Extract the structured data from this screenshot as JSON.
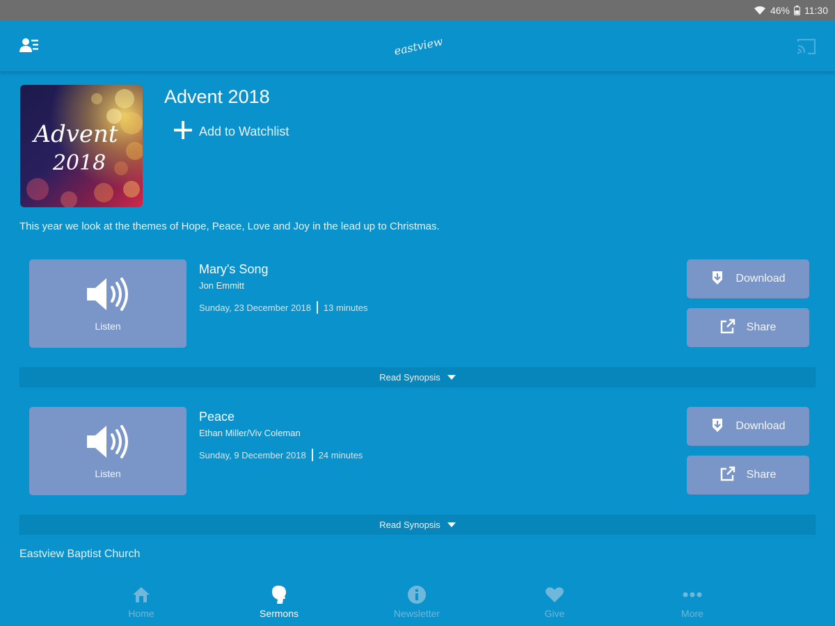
{
  "status_bar": {
    "battery": "46%",
    "time": "11:30"
  },
  "app_bar": {
    "logo_text": "eastview"
  },
  "series": {
    "title": "Advent 2018",
    "art_line1": "Advent",
    "art_line2": "2018",
    "watchlist_label": "Add to Watchlist",
    "description": "This year we look at the themes of Hope, Peace, Love and Joy in the lead up to Christmas."
  },
  "sermons": [
    {
      "title": "Mary's Song",
      "speaker": "Jon Emmitt",
      "date": "Sunday, 23 December 2018",
      "duration": "13 minutes",
      "listen_label": "Listen",
      "download_label": "Download",
      "share_label": "Share",
      "synopsis_label": "Read Synopsis"
    },
    {
      "title": "Peace",
      "speaker": "Ethan Miller/Viv Coleman",
      "date": "Sunday, 9 December 2018",
      "duration": "24 minutes",
      "listen_label": "Listen",
      "download_label": "Download",
      "share_label": "Share",
      "synopsis_label": "Read Synopsis"
    }
  ],
  "footer": {
    "church_name": "Eastview Baptist Church"
  },
  "tabs": [
    {
      "label": "Home",
      "icon": "home-icon",
      "active": false
    },
    {
      "label": "Sermons",
      "icon": "head-icon",
      "active": true
    },
    {
      "label": "Newsletter",
      "icon": "info-icon",
      "active": false
    },
    {
      "label": "Give",
      "icon": "heart-icon",
      "active": false
    },
    {
      "label": "More",
      "icon": "more-icon",
      "active": false
    }
  ],
  "colors": {
    "background": "#0992cc",
    "tile": "#7a96c8",
    "synopsis_bar": "#0786bc",
    "status_bar": "#6e6e6e",
    "tab_inactive": "#6fb8da"
  }
}
